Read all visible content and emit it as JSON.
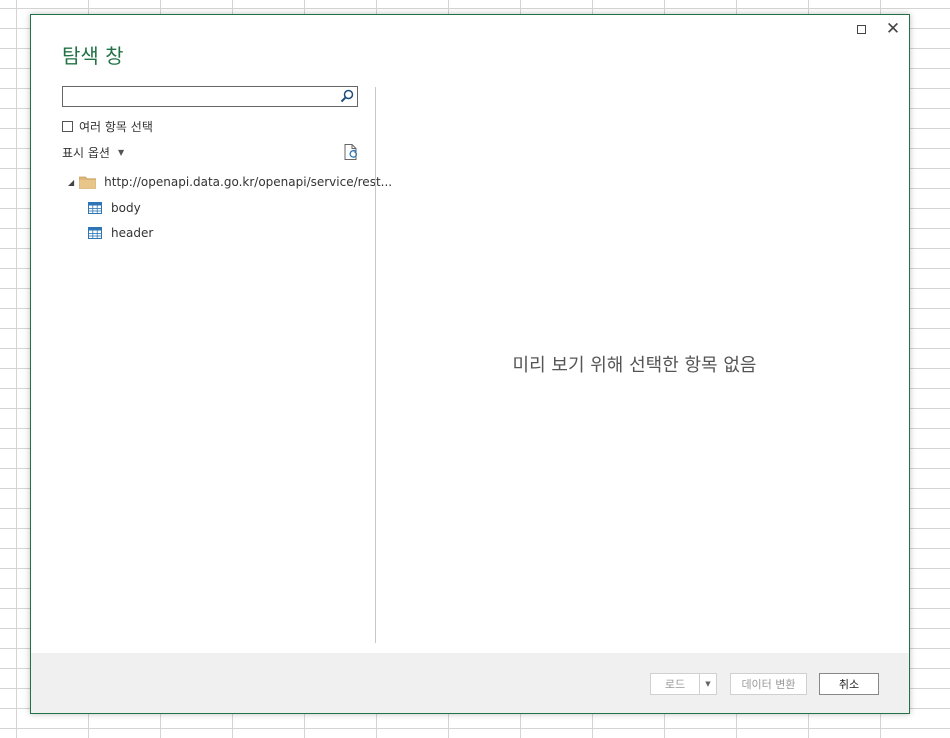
{
  "dialog": {
    "title": "탐색 창",
    "window_controls": {
      "maximize_icon": "maximize-icon",
      "close_glyph": "✕"
    }
  },
  "left_pane": {
    "search": {
      "value": "",
      "placeholder": ""
    },
    "multi_select_label": "여러 항목 선택",
    "multi_select_checked": false,
    "display_options_label": "표시 옵션",
    "tree": {
      "root_label": "http://openapi.data.go.kr/openapi/service/rest...",
      "root_expanded": true,
      "items": [
        {
          "label": "body",
          "icon": "table-icon"
        },
        {
          "label": "header",
          "icon": "table-icon"
        }
      ]
    }
  },
  "preview": {
    "empty_message": "미리 보기 위해 선택한 항목 없음"
  },
  "footer": {
    "load_label": "로드",
    "transform_label": "데이터 변환",
    "cancel_label": "취소"
  },
  "colors": {
    "accent": "#217346",
    "grid": "#d4d4d4",
    "footer_bg": "#f0f0f0"
  }
}
